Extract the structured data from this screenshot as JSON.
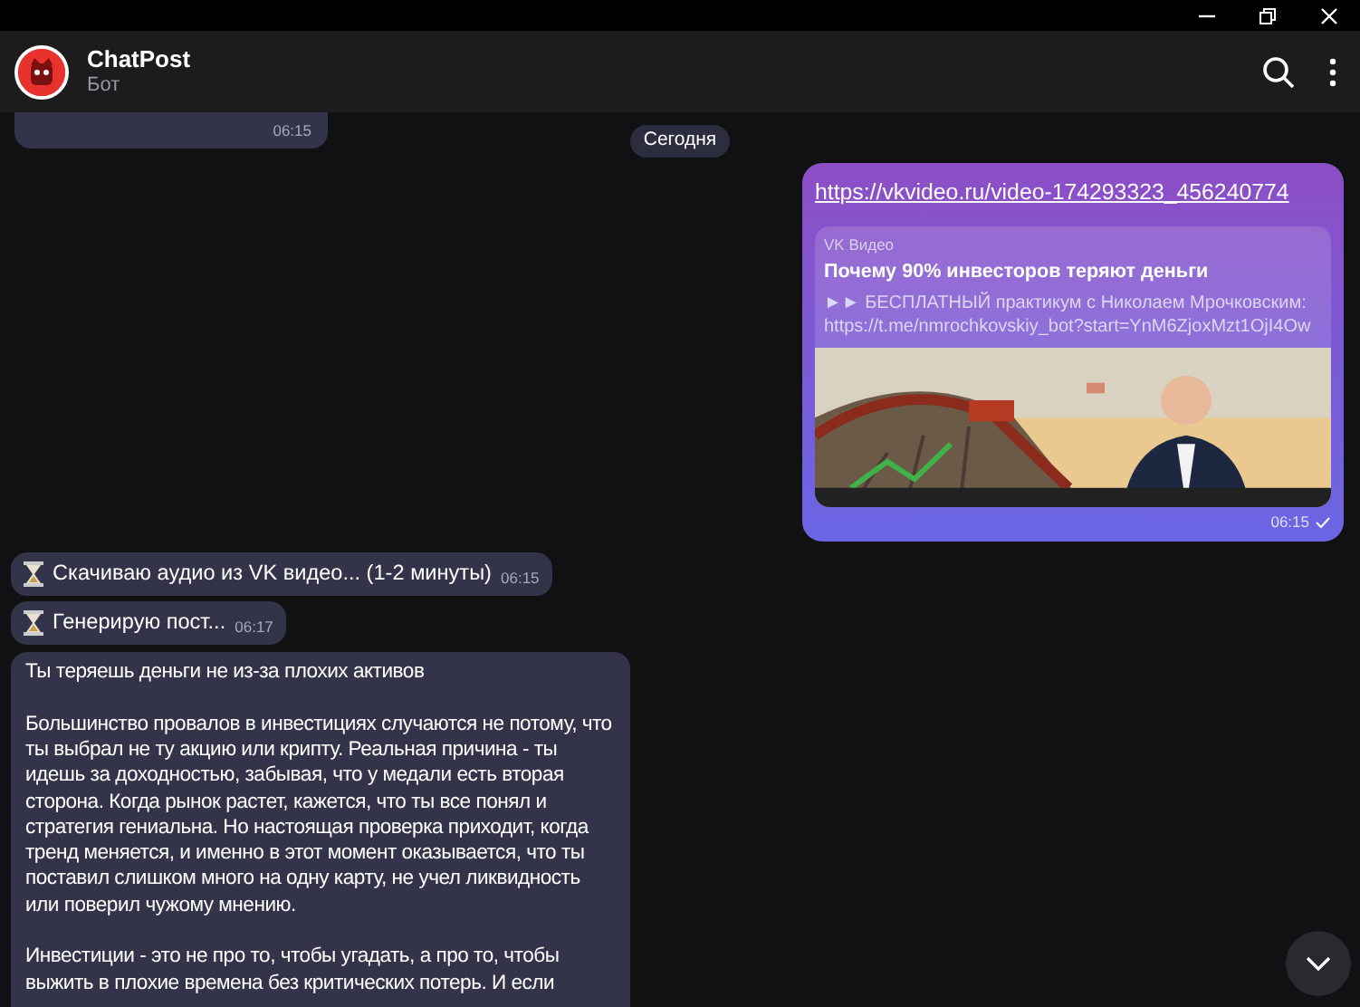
{
  "header": {
    "title": "ChatPost",
    "subtitle": "Бот"
  },
  "messages": [
    {
      "kind": "clipped",
      "outgoing": false,
      "time": "06:15"
    },
    {
      "kind": "date",
      "text": "Сегодня"
    },
    {
      "kind": "link",
      "outgoing": true,
      "text": "https://vkvideo.ru/video-174293323_456240774",
      "preview": {
        "site": "VK Видео",
        "title": "Почему 90% инвесторов теряют деньги",
        "description": "►► БЕСПЛАТНЫЙ практикум с Николаем Мрочковским: https://t.me/nmrochkovskiy_bot?start=YnM6ZjoxMzt1OjI4Ow",
        "kind": "picture"
      },
      "time": "06:15",
      "read": true
    },
    {
      "kind": "status",
      "outgoing": false,
      "text": "Скачиваю аудио из VK видео... (1-2 минуты)",
      "time": "06:15"
    },
    {
      "kind": "status",
      "outgoing": false,
      "text": "Генерирую пост...",
      "time": "06:17"
    },
    {
      "kind": "text",
      "outgoing": false,
      "paragraphs": [
        "Ты теряешь деньги не из-за плохих активов",
        "Большинство провалов в инвестициях случаются не потому, что ты выбрал не ту акцию или крипту. Реальная причина - ты идешь за доходностью, забывая, что у медали есть вторая сторона. Когда рынок растет, кажется, что ты все понял и стратегия гениальна. Но настоящая проверка приходит, когда тренд меняется, и именно в этот момент оказывается, что ты поставил слишком много на одну карту, не учел ликвидность или поверил чужому мнению.",
        "Инвестиции - это не про то, чтобы угадать, а про то, чтобы выжить в плохие времена без критических потерь. И если"
      ]
    }
  ]
}
